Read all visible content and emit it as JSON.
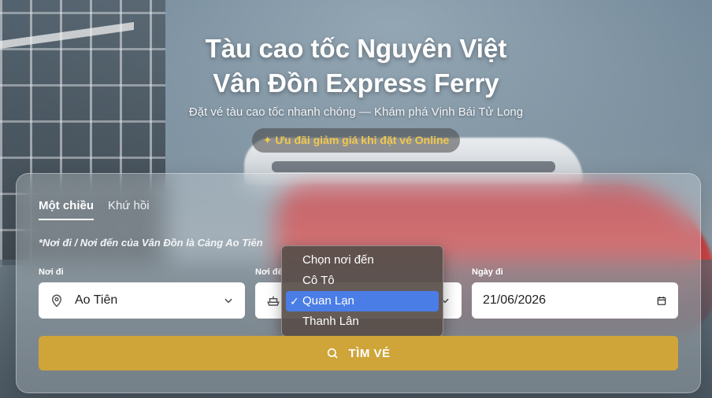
{
  "header": {
    "title_line1": "Tàu cao tốc Nguyên Việt",
    "title_line2": "Vân Đồn Express Ferry",
    "subtitle": "Đặt vé tàu cao tốc nhanh chóng — Khám phá Vịnh Bái Tử Long",
    "promo_icon": "party-popper-icon",
    "promo_text": "Ưu đãi giảm giá khi đặt vé Online"
  },
  "booking": {
    "tabs": [
      {
        "label": "Một chiều",
        "active": true
      },
      {
        "label": "Khứ hồi",
        "active": false
      }
    ],
    "note": "*Nơi đi / Nơi đến của Vân Đồn là Cảng Ao Tiên",
    "from": {
      "label": "Nơi đi",
      "value": "Ao Tiên",
      "icon": "location-pin-icon"
    },
    "to": {
      "label": "Nơi đế",
      "icon": "ship-icon",
      "dropdown_options": [
        {
          "label": "Chọn nơi đến",
          "selected": false
        },
        {
          "label": "Cô Tô",
          "selected": false
        },
        {
          "label": "Quan Lạn",
          "selected": true
        },
        {
          "label": "Thanh Lân",
          "selected": false
        }
      ]
    },
    "date": {
      "label": "Ngày đi",
      "value": "21/06/2026",
      "icon": "calendar-icon"
    },
    "search_button": "TÌM VÉ"
  },
  "colors": {
    "accent_gold": "#cfa53a",
    "promo_text": "#f2c94c",
    "dropdown_selected": "#4a7de6"
  }
}
